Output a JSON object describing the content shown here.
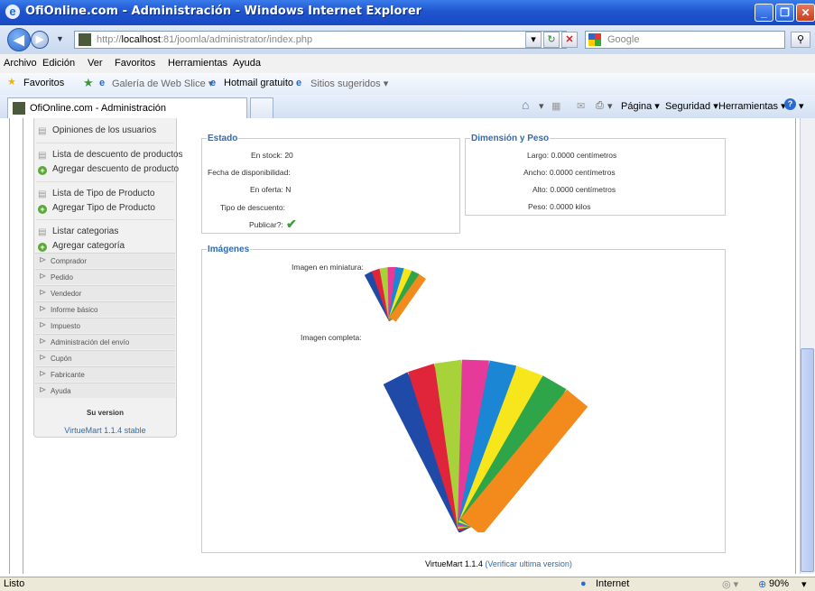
{
  "window": {
    "title": "OfiOnline.com - Administración - Windows Internet Explorer",
    "min_label": "_",
    "max_label": "❐",
    "close_label": "✕"
  },
  "addressbar": {
    "url_prefix": "http://",
    "url_host": "localhost",
    "url_rest": ":81/joomla/administrator/index.php",
    "search_placeholder": "Google"
  },
  "menubar": {
    "items": [
      "Archivo",
      "Edición",
      "Ver",
      "Favoritos",
      "Herramientas",
      "Ayuda"
    ]
  },
  "favorites": {
    "label": "Favoritos",
    "items": [
      "Galería de Web Slice ▾",
      "Hotmail gratuito",
      "Sitios sugeridos ▾"
    ]
  },
  "tabs": {
    "active_title": "OfiOnline.com - Administración"
  },
  "commandbar": {
    "pagina": "Página ▾",
    "seguridad": "Seguridad ▾",
    "herramientas": "Herramientas ▾"
  },
  "sidebar": {
    "items": [
      {
        "icon": "doc",
        "label": "Opiniones de los usuarios"
      },
      {
        "icon": "doc",
        "label": "Lista de descuento de productos"
      },
      {
        "icon": "add",
        "label": "Agregar descuento de producto"
      },
      {
        "icon": "doc",
        "label": "Lista de Tipo de Producto"
      },
      {
        "icon": "add",
        "label": "Agregar Tipo de Producto"
      },
      {
        "icon": "doc",
        "label": "Listar categorias"
      },
      {
        "icon": "add",
        "label": "Agregar categoría"
      }
    ],
    "groups": [
      "Comprador",
      "Pedido",
      "Vendedor",
      "Informe básico",
      "Impuesto",
      "Administración del envío",
      "Cupón",
      "Fabricante",
      "Ayuda"
    ],
    "version_title": "Su version",
    "version_value": "VirtueMart 1.1.4 stable"
  },
  "estado": {
    "legend": "Estado",
    "stock": "En stock: 20",
    "disponibilidad": "Fecha de disponibilidad:",
    "oferta": "En oferta: N",
    "descuento": "Tipo de descuento:",
    "publicar": "Publicar?:"
  },
  "dimension": {
    "legend": "Dimensión y Peso",
    "largo": "Largo: 0.0000 centímetros",
    "ancho": "Ancho: 0.0000 centímetros",
    "alto": "Alto: 0.0000 centímetros",
    "peso": "Peso: 0.0000 kilos"
  },
  "imagenes": {
    "legend": "Imágenes",
    "miniatura_label": "Imagen en miniatura:",
    "completa_label": "Imagen completa:",
    "strip_colors": [
      "#1f4aa8",
      "#e0243a",
      "#a8d23a",
      "#e63a9a",
      "#1a86d4",
      "#f7e61c",
      "#2fa54a",
      "#f28a1c"
    ]
  },
  "footer": {
    "version": "VirtueMart 1.1.4",
    "link": "(Verificar ultima version)"
  },
  "status": {
    "left": "Listo",
    "zone": "Internet",
    "zoom": "90%"
  }
}
